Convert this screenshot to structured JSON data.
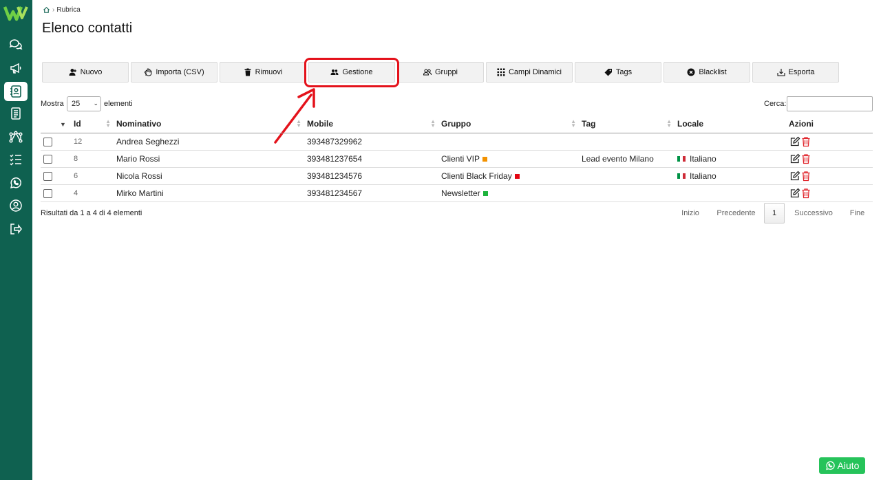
{
  "breadcrumb": {
    "current": "Rubrica"
  },
  "page": {
    "title": "Elenco contatti"
  },
  "toolbar": {
    "new_label": "Nuovo",
    "import_label": "Importa (CSV)",
    "remove_label": "Rimuovi",
    "manage_label": "Gestione",
    "groups_label": "Gruppi",
    "dynamic_fields_label": "Campi Dinamici",
    "tags_label": "Tags",
    "blacklist_label": "Blacklist",
    "export_label": "Esporta"
  },
  "length": {
    "prefix": "Mostra",
    "value": "25",
    "suffix": "elementi"
  },
  "search": {
    "label": "Cerca:",
    "value": ""
  },
  "table": {
    "headers": {
      "id": "Id",
      "name": "Nominativo",
      "mobile": "Mobile",
      "group": "Gruppo",
      "tag": "Tag",
      "locale": "Locale",
      "actions": "Azioni"
    },
    "rows": [
      {
        "id": "12",
        "name": "Andrea Seghezzi",
        "mobile": "393487329962",
        "group": "",
        "group_color": "",
        "tag": "",
        "locale": ""
      },
      {
        "id": "8",
        "name": "Mario Rossi",
        "mobile": "393481237654",
        "group": "Clienti VIP",
        "group_color": "#f39200",
        "tag": "Lead evento Milano",
        "locale": "Italiano"
      },
      {
        "id": "6",
        "name": "Nicola Rossi",
        "mobile": "393481234576",
        "group": "Clienti Black Friday",
        "group_color": "#e30613",
        "tag": "",
        "locale": "Italiano"
      },
      {
        "id": "4",
        "name": "Mirko Martini",
        "mobile": "393481234567",
        "group": "Newsletter",
        "group_color": "#1db33c",
        "tag": "",
        "locale": ""
      }
    ]
  },
  "footer": {
    "results_text": "Risultati da 1 a 4 di 4 elementi"
  },
  "pagination": {
    "first": "Inizio",
    "previous": "Precedente",
    "current": "1",
    "next": "Successivo",
    "last": "Fine"
  },
  "help": {
    "label": "Aiuto"
  },
  "colors": {
    "sidebar": "#0f6150",
    "highlight": "#e4121b",
    "help": "#26c35a"
  }
}
